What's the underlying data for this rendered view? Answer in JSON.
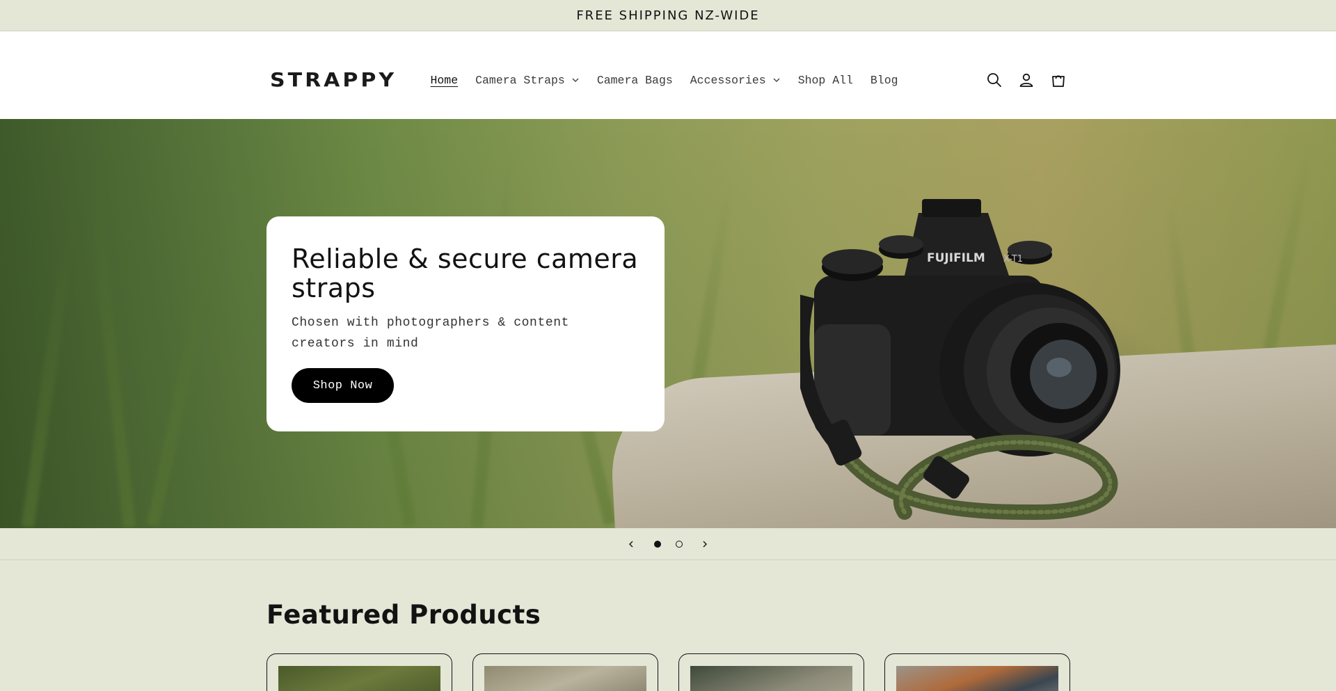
{
  "announcement": {
    "text": "FREE SHIPPING NZ-WIDE"
  },
  "header": {
    "logo": "STRAPPY",
    "nav": [
      {
        "label": "Home",
        "active": true,
        "dropdown": false
      },
      {
        "label": "Camera Straps",
        "active": false,
        "dropdown": true
      },
      {
        "label": "Camera Bags",
        "active": false,
        "dropdown": false
      },
      {
        "label": "Accessories",
        "active": false,
        "dropdown": true
      },
      {
        "label": "Shop All",
        "active": false,
        "dropdown": false
      },
      {
        "label": "Blog",
        "active": false,
        "dropdown": false
      }
    ],
    "icons": [
      "search-icon",
      "account-icon",
      "cart-icon"
    ]
  },
  "hero": {
    "title": "Reliable & secure camera straps",
    "subtitle": "Chosen with photographers & content creators in mind",
    "button": "Shop Now",
    "camera_brand": "FUJIFILM",
    "camera_model": "X-T1"
  },
  "slider": {
    "slides": 2,
    "current": 1
  },
  "featured": {
    "title": "Featured Products",
    "products": [
      {
        "image": "product-image-1"
      },
      {
        "image": "product-image-2"
      },
      {
        "image": "product-image-3"
      },
      {
        "image": "product-image-4"
      }
    ]
  },
  "colors": {
    "background": "#e4e6d6",
    "header_bg": "#ffffff",
    "button_bg": "#000000",
    "text": "#121212"
  }
}
